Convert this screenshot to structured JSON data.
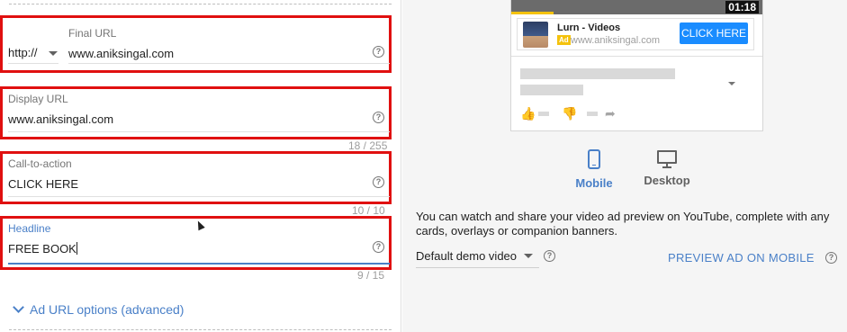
{
  "form": {
    "final_url": {
      "label": "Final URL",
      "protocol": "http://",
      "value": "www.aniksingal.com",
      "help_icon": "help-icon"
    },
    "display_url": {
      "label": "Display URL",
      "value": "www.aniksingal.com",
      "counter": "18 / 255",
      "help_icon": "help-icon"
    },
    "call_to_action": {
      "label": "Call-to-action",
      "value": "CLICK HERE",
      "counter": "10 / 10",
      "help_icon": "help-icon"
    },
    "headline": {
      "label": "Headline",
      "value": "FREE BOOK",
      "counter": "9 / 15",
      "help_icon": "help-icon"
    },
    "advanced_link": "Ad URL options (advanced)"
  },
  "preview": {
    "video_time": "01:18",
    "ad_card": {
      "title": "Lurn - Videos",
      "badge": "Ad",
      "url": "www.aniksingal.com",
      "cta": "CLICK HERE"
    },
    "tabs": [
      {
        "label": "Mobile",
        "icon": "smartphone-icon",
        "active": true
      },
      {
        "label": "Desktop",
        "icon": "monitor-icon",
        "active": false
      }
    ],
    "info_text": "You can watch and share your video ad preview on YouTube, complete with any cards, overlays or companion banners.",
    "demo_select": "Default demo video",
    "preview_link": "PREVIEW AD ON MOBILE"
  },
  "colors": {
    "highlight_border": "#e01010",
    "accent_blue": "#4a80c8",
    "cta_blue": "#1a8cff",
    "ad_badge_yellow": "#f4c20d"
  }
}
